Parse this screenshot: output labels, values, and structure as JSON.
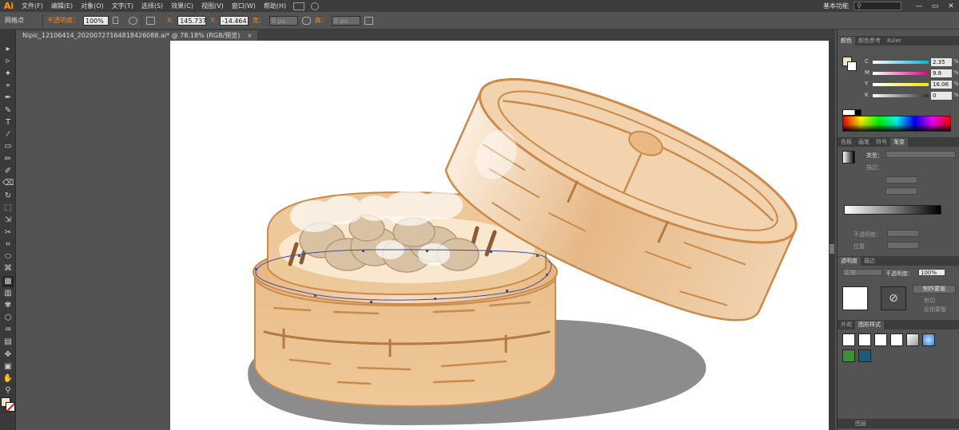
{
  "app": {
    "logo": "Ai",
    "menus": [
      "文件(F)",
      "编辑(E)",
      "对象(O)",
      "文字(T)",
      "选择(S)",
      "效果(C)",
      "视图(V)",
      "窗口(W)",
      "帮助(H)"
    ],
    "workspace": "基本功能",
    "search_placeholder": "",
    "window_buttons": [
      "—",
      "▭",
      "✕"
    ]
  },
  "control": {
    "tool_label": "网格点",
    "opacity_label": "不透明度：",
    "opacity_value": "100%",
    "x_label": "X:",
    "x_value": "145.737",
    "y_label": "Y:",
    "y_value": "-14.464",
    "w_label": "宽：",
    "w_value": "0 px",
    "h_label": "高：",
    "h_value": "0 px"
  },
  "document": {
    "tab_title": "Nipic_12106414_20200727164818426088.ai*",
    "zoom_info": "@ 78.18% (RGB/预览)",
    "close": "×"
  },
  "tools": [
    "▸",
    "▹",
    "✦",
    "⌖",
    "✒",
    "✎",
    "T",
    "⁄",
    "▭",
    "✏",
    "✐",
    "⌫",
    "↻",
    "⬚",
    "⇲",
    "✂",
    "⌗",
    "⬭",
    "⌘",
    "▦",
    "▥",
    "✾",
    "⬡",
    "♒",
    "▤",
    "✥",
    "▣",
    "✋",
    "⚲"
  ],
  "color_panel": {
    "tabs": [
      "颜色",
      "颜色参考",
      "Kuler"
    ],
    "channels": [
      {
        "label": "C",
        "value": "2.35",
        "unit": "%",
        "color": "#00b4d8"
      },
      {
        "label": "M",
        "value": "9.8",
        "unit": "%",
        "color": "#e0008a"
      },
      {
        "label": "Y",
        "value": "16.06",
        "unit": "%",
        "color": "#f1e600"
      },
      {
        "label": "K",
        "value": "0",
        "unit": "%",
        "color": "#333333"
      }
    ],
    "fill_color": "#f3e3c6"
  },
  "gradient_panel": {
    "tabs": [
      "色板",
      "画笔",
      "符号",
      "渐变"
    ],
    "type_label": "类型：",
    "stroke_label": "描边：",
    "opacity_label": "不透明度：",
    "location_label": "位置："
  },
  "transparency_panel": {
    "tabs": [
      "透明度",
      "描边"
    ],
    "mode_value": "正常",
    "opacity_label": "不透明度：",
    "opacity_value": "100%",
    "make_mask_button": "制作蒙版",
    "clip_label": "剪切",
    "invert_label": "反相蒙版"
  },
  "graphic_styles_panel": {
    "tabs": [
      "外观",
      "图形样式"
    ]
  },
  "layers_panel": {
    "tabs": [
      "图层"
    ]
  }
}
